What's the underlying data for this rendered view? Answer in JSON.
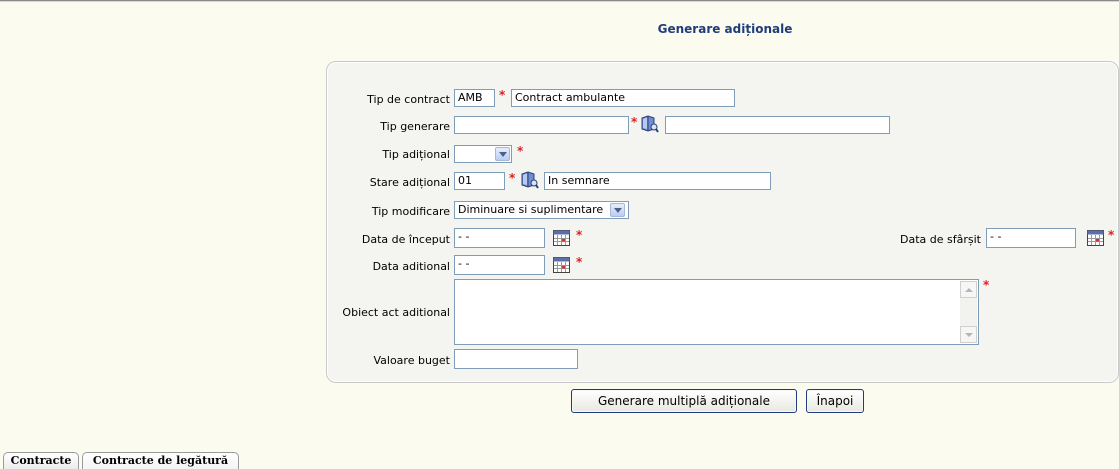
{
  "page_title": "Generare adiționale",
  "form": {
    "tip_contract": {
      "label": "Tip de contract",
      "code": "AMB",
      "name": "Contract ambulante"
    },
    "tip_generare": {
      "label": "Tip generare",
      "code": "",
      "name": ""
    },
    "tip_aditional": {
      "label": "Tip adițional",
      "value": ""
    },
    "stare_aditional": {
      "label": "Stare adițional",
      "code": "01",
      "name": "In semnare"
    },
    "tip_modificare": {
      "label": "Tip modificare",
      "value": "Diminuare si suplimentare"
    },
    "data_inceput": {
      "label": "Data de început",
      "value": " -   - "
    },
    "data_sfarsit": {
      "label": "Data de sfârșit",
      "value": " -   - "
    },
    "data_aditional": {
      "label": "Data aditional",
      "value": " -   - "
    },
    "obiect_act": {
      "label": "Obiect act aditional",
      "value": ""
    },
    "valoare_buget": {
      "label": "Valoare buget",
      "value": ""
    },
    "required_mark": "*"
  },
  "buttons": {
    "generate": "Generare multiplă adiționale",
    "back": "Înapoi"
  },
  "tabs": [
    "Contracte",
    "Contracte de legătură"
  ],
  "icons": {
    "lookup": "book-lookup-icon",
    "calendar": "calendar-icon",
    "dropdown": "chevron-down-icon"
  },
  "colors": {
    "title": "#1f3d7a",
    "required": "#e02020",
    "background": "#fbfbef"
  }
}
